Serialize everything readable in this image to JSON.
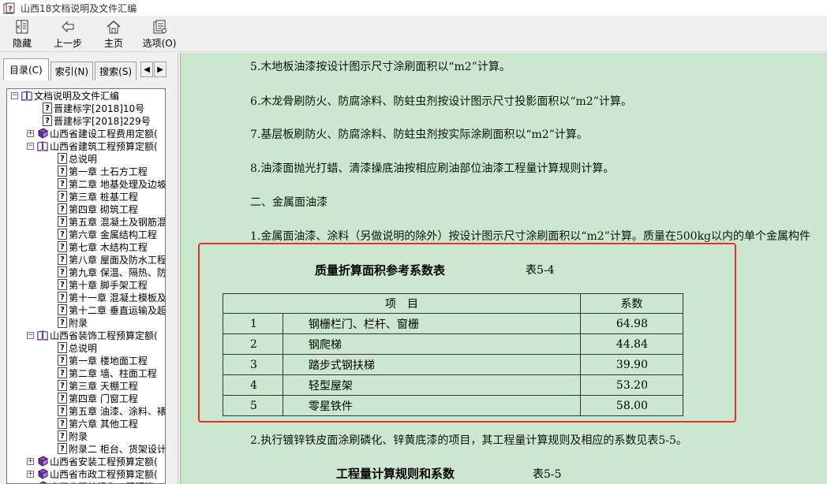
{
  "window": {
    "title": "山西18文档说明及文件汇编"
  },
  "toolbar": {
    "hide": "隐藏",
    "back": "上一步",
    "home": "主页",
    "options": "选项(O)"
  },
  "tabs": {
    "contents": "目录(C)",
    "index": "索引(N)",
    "search": "搜索(S)"
  },
  "tree": [
    {
      "indent": 0,
      "expander": "−",
      "icon": "book-open",
      "label": "文档说明及文件汇编"
    },
    {
      "indent": 1,
      "expander": "",
      "icon": "help",
      "label": "晋建标字[2018]10号"
    },
    {
      "indent": 1,
      "expander": "",
      "icon": "help",
      "label": "晋建标字[2018]229号"
    },
    {
      "indent": 1,
      "expander": "+",
      "icon": "book-closed",
      "label": "山西省建设工程费用定额("
    },
    {
      "indent": 1,
      "expander": "−",
      "icon": "book-open",
      "label": "山西省建筑工程预算定额("
    },
    {
      "indent": 2,
      "expander": "",
      "icon": "help",
      "label": "总说明"
    },
    {
      "indent": 2,
      "expander": "",
      "icon": "help",
      "label": "第一章 土石方工程"
    },
    {
      "indent": 2,
      "expander": "",
      "icon": "help",
      "label": "第二章 地基处理及边坡"
    },
    {
      "indent": 2,
      "expander": "",
      "icon": "help",
      "label": "第三章 桩基工程"
    },
    {
      "indent": 2,
      "expander": "",
      "icon": "help",
      "label": "第四章 砌筑工程"
    },
    {
      "indent": 2,
      "expander": "",
      "icon": "help",
      "label": "第五章 混凝土及钢筋混"
    },
    {
      "indent": 2,
      "expander": "",
      "icon": "help",
      "label": "第六章 金属结构工程"
    },
    {
      "indent": 2,
      "expander": "",
      "icon": "help",
      "label": "第七章 木结构工程"
    },
    {
      "indent": 2,
      "expander": "",
      "icon": "help",
      "label": "第八章 屋面及防水工程"
    },
    {
      "indent": 2,
      "expander": "",
      "icon": "help",
      "label": "第九章 保温、隔热、防"
    },
    {
      "indent": 2,
      "expander": "",
      "icon": "help",
      "label": "第十章 脚手架工程"
    },
    {
      "indent": 2,
      "expander": "",
      "icon": "help",
      "label": "第十一章 混凝土模板及"
    },
    {
      "indent": 2,
      "expander": "",
      "icon": "help",
      "label": "第十二章 垂直运输及超"
    },
    {
      "indent": 2,
      "expander": "",
      "icon": "help",
      "label": "附录"
    },
    {
      "indent": 1,
      "expander": "−",
      "icon": "book-open",
      "label": "山西省装饰工程预算定额("
    },
    {
      "indent": 2,
      "expander": "",
      "icon": "help",
      "label": "总说明"
    },
    {
      "indent": 2,
      "expander": "",
      "icon": "help",
      "label": "第一章 楼地面工程"
    },
    {
      "indent": 2,
      "expander": "",
      "icon": "help",
      "label": "第二章 墙、柱面工程"
    },
    {
      "indent": 2,
      "expander": "",
      "icon": "help",
      "label": "第三章 天棚工程"
    },
    {
      "indent": 2,
      "expander": "",
      "icon": "help",
      "label": "第四章 门窗工程"
    },
    {
      "indent": 2,
      "expander": "",
      "icon": "help",
      "label": "第五章 油漆、涂料、裱"
    },
    {
      "indent": 2,
      "expander": "",
      "icon": "help",
      "label": "第六章 其他工程"
    },
    {
      "indent": 2,
      "expander": "",
      "icon": "help",
      "label": "附录"
    },
    {
      "indent": 2,
      "expander": "",
      "icon": "help",
      "label": "附录二 柜台、货架设计"
    },
    {
      "indent": 1,
      "expander": "+",
      "icon": "book-closed",
      "label": "山西省安装工程预算定额("
    },
    {
      "indent": 1,
      "expander": "+",
      "icon": "book-closed",
      "label": "山西省市政工程预算定额("
    },
    {
      "indent": 1,
      "expander": "+",
      "icon": "book-closed",
      "label": "山西省园林绿化工程预算"
    }
  ],
  "content": {
    "p5": "5.木地板油漆按设计图示尺寸涂刷面积以“m2”计算。",
    "p6": "6.木龙骨刷防火、防腐涂料、防蛀虫剂按设计图示尺寸投影面积以“m2”计算。",
    "p7": "7.基层板刷防火、防腐涂料、防蛀虫剂按实际涂刷面积以“m2”计算。",
    "p8": "8.油漆面抛光打蜡、清漆操底油按相应刷油部位油漆工程量计算规则计算。",
    "section2": "二、金属面油漆",
    "p21": "1.金属面油漆、涂料（另做说明的除外）按设计图示尺寸涂刷面积以“m2”计算。质量在500kg以内的单个金属构件",
    "table_title": "质量折算面积参考系数表",
    "table_code": "表5-4",
    "table_header": {
      "item": "项　目",
      "coef": "系数"
    },
    "table_rows": [
      {
        "no": "1",
        "name": "钢栅栏门、栏杆、窗栅",
        "coef": "64.98"
      },
      {
        "no": "2",
        "name": "钢爬梯",
        "coef": "44.84"
      },
      {
        "no": "3",
        "name": "踏步式钢扶梯",
        "coef": "39.90"
      },
      {
        "no": "4",
        "name": "轻型屋架",
        "coef": "53.20"
      },
      {
        "no": "5",
        "name": "零星铁件",
        "coef": "58.00"
      }
    ],
    "p22": "2.执行镀锌铁皮面涂刷磷化、锌黄底漆的项目，其工程量计算规则及相应的系数见表5-5。",
    "table2_title": "工程量计算规则和系数",
    "table2_code": "表5-5"
  },
  "colors": {
    "content_bg": "#cbe8cf",
    "highlight": "#e33030"
  }
}
